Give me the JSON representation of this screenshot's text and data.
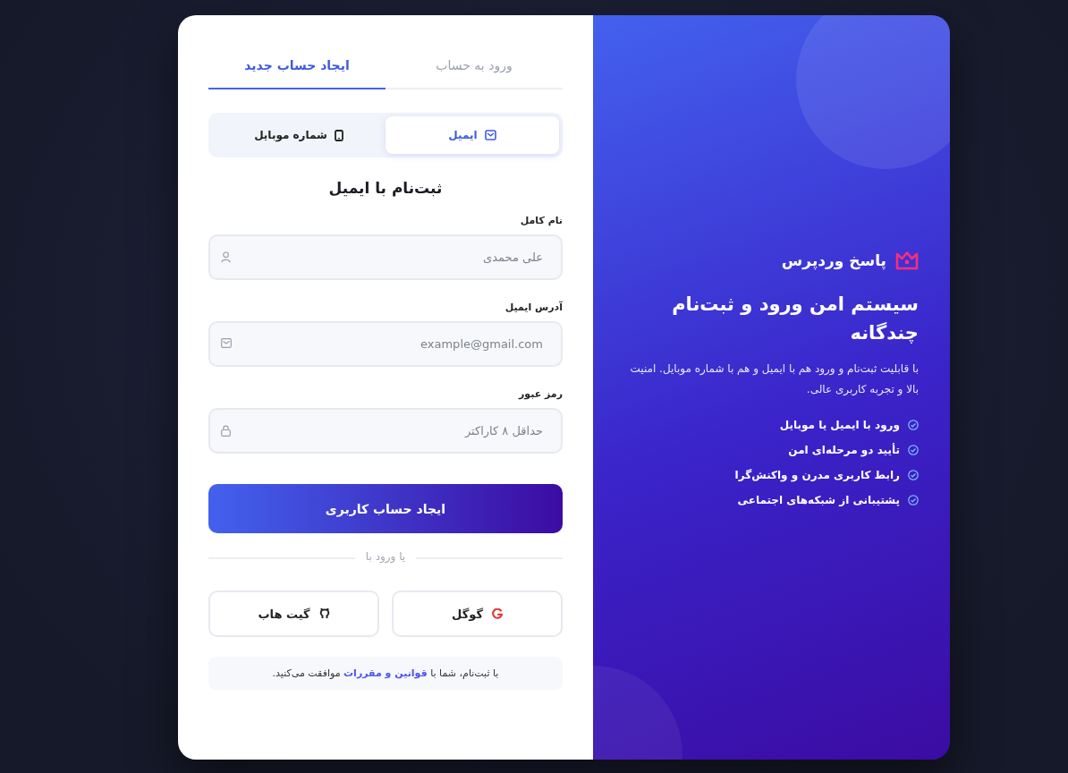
{
  "tabs": [
    {
      "label": "ورود به حساب",
      "selected": false
    },
    {
      "label": "ایجاد حساب جدید",
      "selected": true
    }
  ],
  "methods": [
    {
      "label": "ایمیل",
      "kind": "email",
      "selected": true
    },
    {
      "label": "شماره موبایل",
      "kind": "mobile",
      "selected": false
    }
  ],
  "form_title": "ثبت‌نام با ایمیل",
  "fields": [
    {
      "label": "نام کامل",
      "placeholder": "علی محمدی",
      "kind": "person"
    },
    {
      "label": "آدرس ایمیل",
      "placeholder": "example@gmail.com",
      "kind": "email"
    },
    {
      "label": "رمز عبور",
      "placeholder": "حداقل ۸ کاراکتر",
      "kind": "lock"
    }
  ],
  "submit": "ایجاد حساب کاربری",
  "divider": "یا ورود با",
  "social": [
    {
      "label": "گوگل",
      "kind": "google"
    },
    {
      "label": "گیت هاب",
      "kind": "github"
    }
  ],
  "terms": {
    "before": "با ثبت‌نام، شما با",
    "link": "قوانین و مقررات",
    "after": "موافقت می‌کنید."
  },
  "brand": "پاسخ وردپرس",
  "headline": "سیستم امن ورود و ثبت‌نام چندگانه",
  "description": "با قابلیت ثبت‌نام و ورود هم با ایمیل و هم با شماره موبایل. امنیت بالا و تجربه کاربری عالی.",
  "features": [
    "ورود با ایمیل یا موبایل",
    "تأیید دو مرحله‌ای امن",
    "رابط کاربری مدرن و واکنش‌گرا",
    "پشتیبانی از شبکه‌های اجتماعی"
  ]
}
